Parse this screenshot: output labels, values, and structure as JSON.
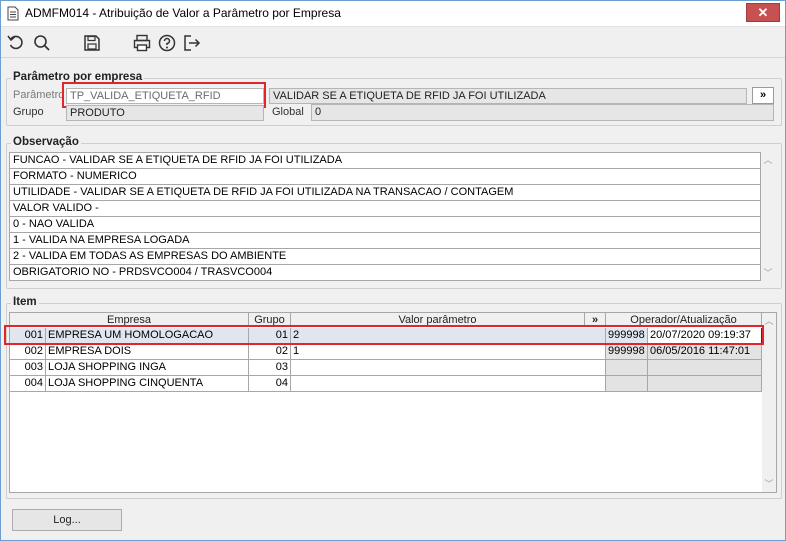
{
  "window": {
    "title": "ADMFM014 - Atribuição de Valor a Parâmetro por Empresa",
    "close_label": "✕"
  },
  "toolbar": {
    "icons": [
      "refresh-icon",
      "search-icon",
      "save-icon",
      "print-icon",
      "help-icon",
      "exit-icon"
    ]
  },
  "parametro_por_empresa": {
    "group_label": "Parâmetro por empresa",
    "parametro_label": "Parâmetro",
    "parametro_value": "TP_VALIDA_ETIQUETA_RFID",
    "parametro_desc": "VALIDAR SE A ETIQUETA DE RFID JA FOI UTILIZADA",
    "expand_label": "»",
    "grupo_label": "Grupo",
    "grupo_value": "PRODUTO",
    "global_label": "Global",
    "global_value": "0"
  },
  "observacao": {
    "group_label": "Observação",
    "lines": [
      "FUNCAO - VALIDAR SE A ETIQUETA DE RFID JA FOI UTILIZADA",
      "FORMATO - NUMERICO",
      "UTILIDADE - VALIDAR SE A ETIQUETA DE RFID JA FOI UTILIZADA NA TRANSACAO / CONTAGEM",
      "VALOR VALIDO -",
      "0 - NAO VALIDA",
      "1 - VALIDA NA EMPRESA LOGADA",
      "2 - VALIDA EM TODAS AS EMPRESAS DO AMBIENTE",
      "OBRIGATORIO NO - PRDSVCO004 / TRASVCO004"
    ]
  },
  "item": {
    "group_label": "Item",
    "columns": {
      "empresa": "Empresa",
      "grupo": "Grupo",
      "valor": "Valor parâmetro",
      "expand": "»",
      "operador": "Operador/Atualização"
    },
    "rows": [
      {
        "code": "001",
        "empresa": "EMPRESA UM HOMOLOGACAO",
        "grupo": "01",
        "valor": "2",
        "operador": "999998",
        "atualizacao": "20/07/2020 09:19:37"
      },
      {
        "code": "002",
        "empresa": "EMPRESA DOIS",
        "grupo": "02",
        "valor": "1",
        "operador": "999998",
        "atualizacao": "06/05/2016 11:47:01"
      },
      {
        "code": "003",
        "empresa": "LOJA SHOPPING INGA",
        "grupo": "03",
        "valor": "",
        "operador": "",
        "atualizacao": ""
      },
      {
        "code": "004",
        "empresa": "LOJA SHOPPING CINQUENTA",
        "grupo": "04",
        "valor": "",
        "operador": "",
        "atualizacao": ""
      }
    ]
  },
  "footer": {
    "log_button": "Log..."
  }
}
